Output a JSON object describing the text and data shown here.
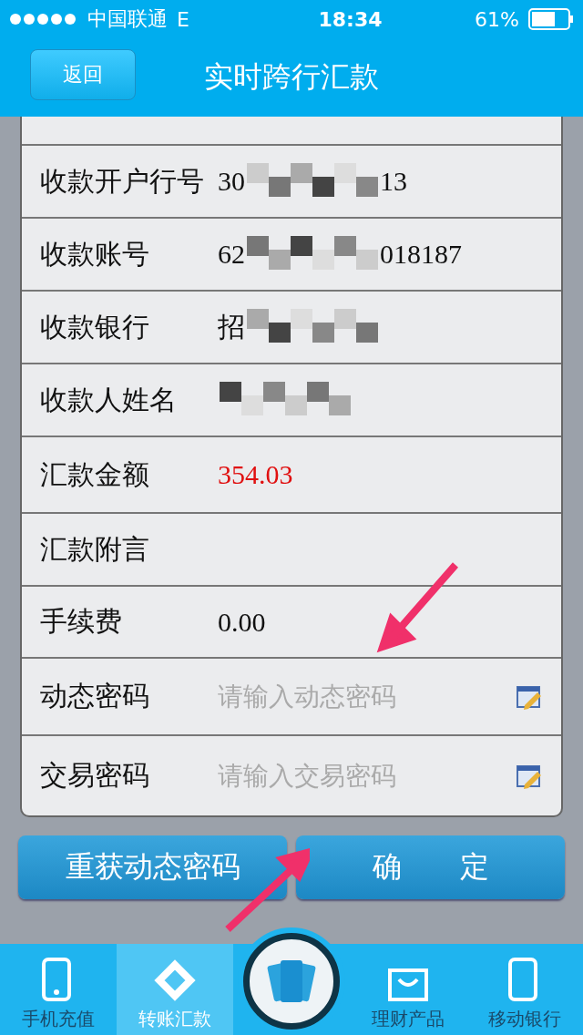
{
  "status_bar": {
    "carrier": "中国联通",
    "network": "E",
    "time": "18:34",
    "battery": "61%"
  },
  "header": {
    "back": "返回",
    "title": "实时跨行汇款"
  },
  "form": [
    {
      "kind": "masked",
      "label": "收款开户行号",
      "visible": [
        "30",
        "13"
      ]
    },
    {
      "kind": "masked",
      "label": "收款账号",
      "visible": [
        "62",
        "018187"
      ]
    },
    {
      "kind": "masked",
      "label": "收款银行",
      "visible": [
        "招"
      ]
    },
    {
      "kind": "masked",
      "label": "收款人姓名"
    },
    {
      "kind": "amount",
      "label": "汇款金额",
      "value": "354.03"
    },
    {
      "kind": "text",
      "label": "汇款附言"
    },
    {
      "kind": "text",
      "label": "手续费",
      "value": "0.00"
    },
    {
      "kind": "input",
      "label": "动态密码",
      "placeholder": "请输入动态密码"
    },
    {
      "kind": "input",
      "label": "交易密码",
      "placeholder": "请输入交易密码"
    }
  ],
  "buttons": [
    {
      "label": "重获动态密码"
    },
    {
      "label": "确　　定"
    }
  ],
  "tabs": [
    {
      "label": "手机充值",
      "selected": false
    },
    {
      "label": "转账汇款",
      "selected": true
    },
    {
      "kind": "center"
    },
    {
      "label": "理财产品",
      "selected": false
    },
    {
      "label": "移动银行",
      "selected": false
    }
  ]
}
